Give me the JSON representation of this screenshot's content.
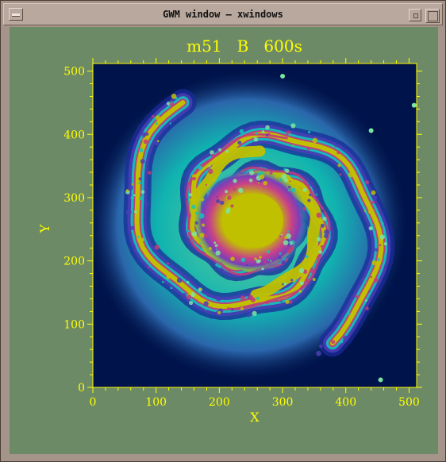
{
  "window": {
    "title": "GWM window – xwindows"
  },
  "colors": {
    "frame": "#a5948a",
    "client_bg": "#6d8a66",
    "axis": "#ffff00",
    "sky": "#00134a"
  },
  "icons": {
    "menu": "window-menu-icon",
    "minimize": "minimize-icon",
    "maximize": "maximize-icon"
  },
  "chart_data": {
    "type": "heatmap",
    "title": "m51   B   600s",
    "xlabel": "X",
    "ylabel": "Y",
    "xlim": [
      0,
      512
    ],
    "ylim": [
      0,
      512
    ],
    "x_ticks": [
      "0",
      "100",
      "200",
      "300",
      "400",
      "500"
    ],
    "y_ticks": [
      "0",
      "100",
      "200",
      "300",
      "400",
      "500"
    ],
    "colormap": [
      "#00134a",
      "#1b2a9a",
      "#4b3fb5",
      "#12c5bb",
      "#7be6a2",
      "#c23c7a",
      "#c0c000"
    ],
    "nucleus": [
      256,
      256
    ]
  }
}
